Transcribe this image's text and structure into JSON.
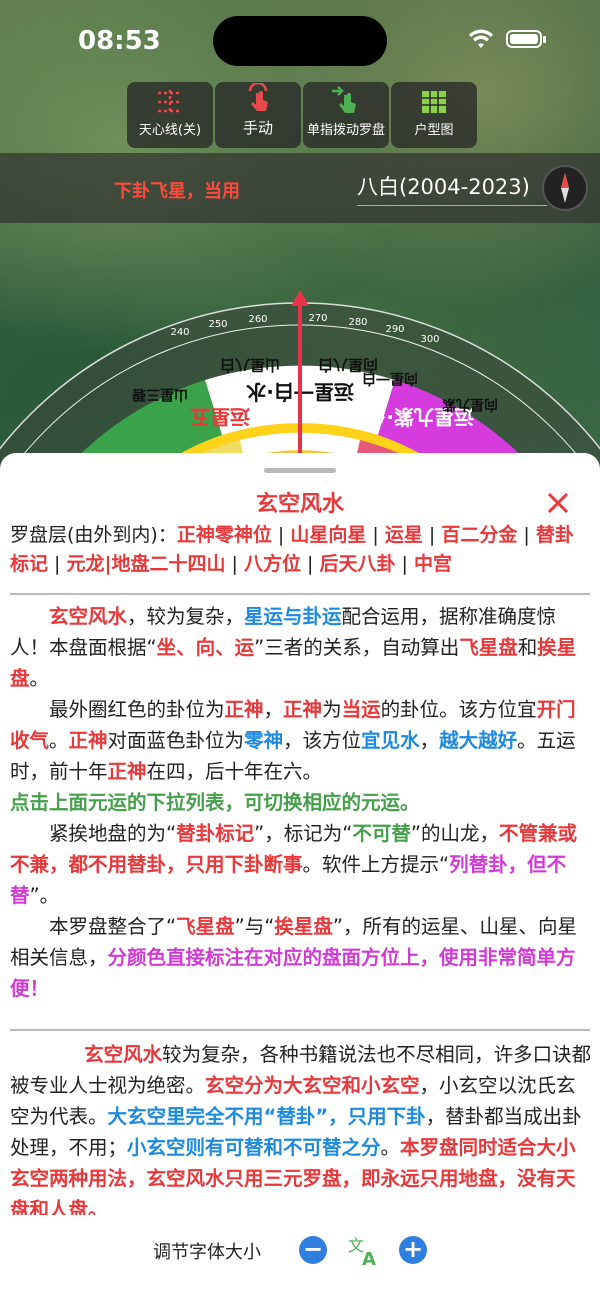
{
  "status_bar": {
    "time": "08:53"
  },
  "toolbar": {
    "items": [
      {
        "label": "天心线(关)",
        "icon": "crosshair-grid-icon"
      },
      {
        "label": "手动",
        "icon": "hand-tap-icon"
      },
      {
        "label": "单指拨动罗盘",
        "icon": "swipe-finger-icon"
      },
      {
        "label": "户型图",
        "icon": "floorplan-grid-icon"
      }
    ]
  },
  "period_bar": {
    "label": "下卦飞星，当用",
    "selected_period": "八白(2004-2023)"
  },
  "compass": {
    "degree_labels": [
      "240",
      "250",
      "260",
      "270",
      "280",
      "290",
      "300"
    ],
    "ring_texts": [
      "运星五",
      "运星一白·水",
      "运星九紫·火",
      "山星八白",
      "向星八白",
      "山星三碧",
      "向星一白",
      "向星九紫"
    ]
  },
  "sheet": {
    "title": "玄空风水",
    "layers_prefix": "罗盘层(由外到内)：",
    "layers": [
      "正神零神位",
      "山星向星",
      "运星",
      "百二分金",
      "替卦标记",
      "元龙|地盘二十四山",
      "八方位",
      "后天八卦",
      "中宫"
    ],
    "section1": {
      "p1": [
        "玄空风水",
        "，较为复杂，",
        "星运与卦运",
        "配合运用，据称准确度惊人！本盘面根据“",
        "坐、向、运",
        "”三者的关系，自动算出",
        "飞星盘",
        "和",
        "挨星盘",
        "。"
      ],
      "p2": [
        "最外圈红色的卦位为",
        "正神",
        "，",
        "正神",
        "为",
        "当运",
        "的卦位。该方位宜",
        "开门收气",
        "。",
        "正神",
        "对面蓝色卦位为",
        "零神",
        "，该方位",
        "宜见水",
        "，",
        "越大越好",
        "。五运时，前十年",
        "正神",
        "在四，后十年在六。"
      ],
      "p2_green": "点击上面元运的下拉列表，可切换相应的元运。",
      "p3": [
        "紧挨地盘的为“",
        "替卦标记",
        "”，标记为“",
        "不可替",
        "”的山龙，",
        "不管兼或不兼，都不用替卦，只用下卦断事",
        "。软件上方提示“",
        "列替卦，但不替",
        "”。"
      ],
      "p4": [
        "本罗盘整合了“",
        "飞星盘",
        "”与“",
        "挨星盘",
        "”，所有的运星、山星、向星相关信息，",
        "分颜色直接标注在对应的盘面方位上，使用非常简单方便！"
      ]
    },
    "section2": {
      "p1": [
        "玄空风水",
        "较为复杂，各种书籍说法也不尽相同，许多口诀都被专业人士视为绝密。",
        "玄空分为大玄空和小玄空",
        "，小玄空以沈氏玄空为代表。",
        "大玄空里完全不用“替卦”，只用下卦",
        "，替卦都当成出卦处理，不用；",
        "小玄空则有可替和不可替之分",
        "。",
        "本罗盘同时适合大小玄空两种用法，玄空风水只用三元罗盘，即永远只用地盘，没有天盘和人盘。"
      ]
    },
    "font_control": {
      "label": "调节字体大小",
      "minus": "−",
      "plus": "+"
    }
  }
}
